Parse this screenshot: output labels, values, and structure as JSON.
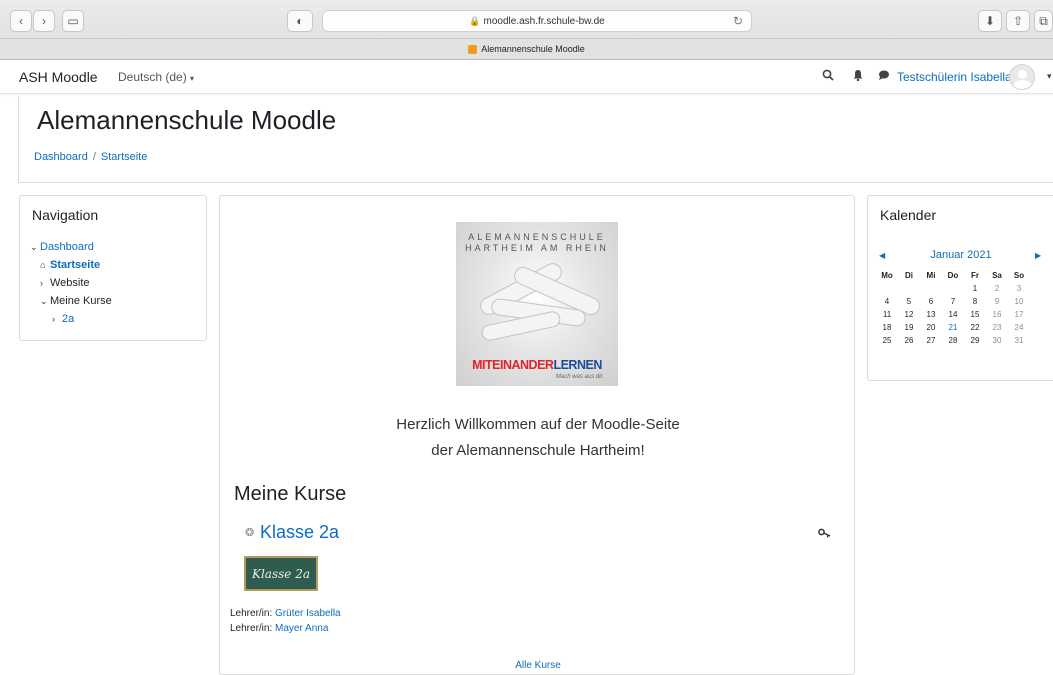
{
  "browser": {
    "url": "moodle.ash.fr.schule-bw.de",
    "tab_title": "Alemannenschule Moodle"
  },
  "navbar": {
    "brand": "ASH Moodle",
    "language": "Deutsch (de)",
    "user_name": "Testschülerin Isabella"
  },
  "header": {
    "title": "Alemannenschule Moodle",
    "breadcrumb": [
      "Dashboard",
      "Startseite"
    ]
  },
  "navigation": {
    "title": "Navigation",
    "items": [
      {
        "label": "Dashboard",
        "level": 0,
        "chevron": "down",
        "style": "link"
      },
      {
        "label": "Startseite",
        "level": 1,
        "chevron": "home",
        "style": "bold-link"
      },
      {
        "label": "Website",
        "level": 1,
        "chevron": "right",
        "style": "text"
      },
      {
        "label": "Meine Kurse",
        "level": 1,
        "chevron": "down",
        "style": "text"
      },
      {
        "label": "2a",
        "level": 2,
        "chevron": "right",
        "style": "link"
      }
    ]
  },
  "main": {
    "logo": {
      "line1": "ALEMANNENSCHULE",
      "line2": "HARTHEIM AM RHEIN",
      "slogan_part1": "MITEINANDER",
      "slogan_part2": "LERNEN",
      "tagline": "Mach was aus dir."
    },
    "welcome_line1": "Herzlich Willkommen auf der Moodle-Seite",
    "welcome_line2": "der Alemannenschule Hartheim!",
    "section_heading": "Meine Kurse",
    "course": {
      "name": "Klasse 2a",
      "image_text": "Klasse 2a",
      "teachers": [
        {
          "role": "Lehrer/in:",
          "name": "Grüter Isabella"
        },
        {
          "role": "Lehrer/in:",
          "name": "Mayer Anna"
        }
      ]
    },
    "all_courses_link": "Alle Kurse"
  },
  "calendar": {
    "title": "Kalender",
    "month": "Januar 2021",
    "weekdays": [
      "Mo",
      "Di",
      "Mi",
      "Do",
      "Fr",
      "Sa",
      "So"
    ],
    "weeks": [
      [
        "",
        "",
        "",
        "",
        "1",
        "2",
        "3"
      ],
      [
        "4",
        "5",
        "6",
        "7",
        "8",
        "9",
        "10"
      ],
      [
        "11",
        "12",
        "13",
        "14",
        "15",
        "16",
        "17"
      ],
      [
        "18",
        "19",
        "20",
        "21",
        "22",
        "23",
        "24"
      ],
      [
        "25",
        "26",
        "27",
        "28",
        "29",
        "30",
        "31"
      ]
    ],
    "today": "21"
  },
  "colors": {
    "link": "#0f6cbf",
    "text": "#1d2125",
    "logo_red": "#e0262c",
    "logo_blue": "#1d4e9e"
  }
}
